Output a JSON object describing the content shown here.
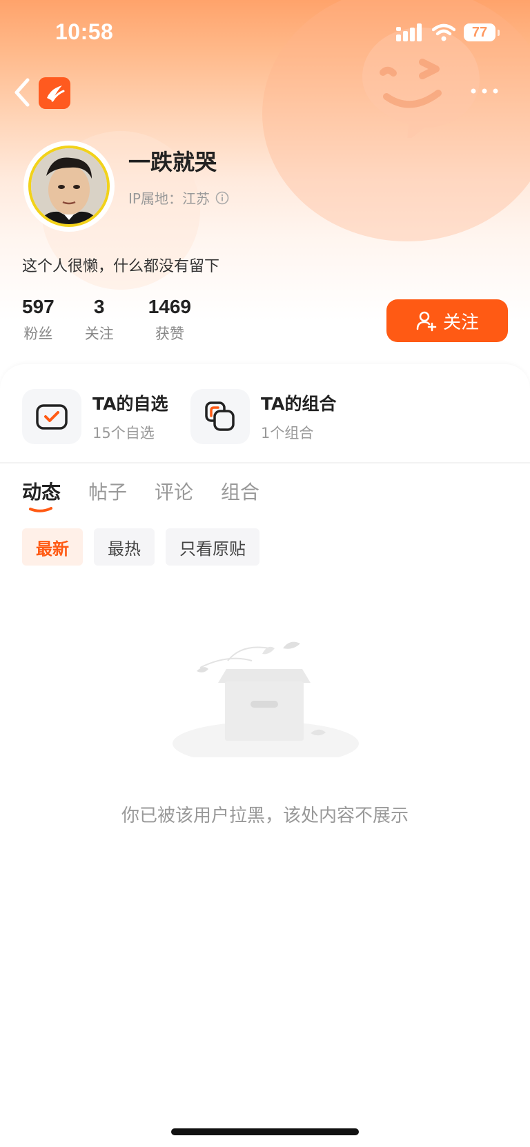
{
  "status_bar": {
    "time": "10:58",
    "battery": "77"
  },
  "nav": {
    "back_icon": "chevron-left-icon",
    "logo_icon": "app-logo-icon",
    "more_icon": "more-icon"
  },
  "profile": {
    "username": "一跌就哭",
    "ip_location": "IP属地：江苏",
    "bio": "这个人很懒，什么都没有留下",
    "stats": [
      {
        "value": "597",
        "label": "粉丝"
      },
      {
        "value": "3",
        "label": "关注"
      },
      {
        "value": "1469",
        "label": "获赞"
      }
    ],
    "follow_button": "关注"
  },
  "quick_links": [
    {
      "title": "TA的自选",
      "subtitle": "15个自选"
    },
    {
      "title": "TA的组合",
      "subtitle": "1个组合"
    }
  ],
  "tabs": [
    {
      "label": "动态",
      "active": true
    },
    {
      "label": "帖子",
      "active": false
    },
    {
      "label": "评论",
      "active": false
    },
    {
      "label": "组合",
      "active": false
    }
  ],
  "filters": [
    {
      "label": "最新",
      "active": true
    },
    {
      "label": "最热",
      "active": false
    },
    {
      "label": "只看原贴",
      "active": false
    }
  ],
  "empty_state": {
    "message": "你已被该用户拉黑，该处内容不展示"
  },
  "colors": {
    "accent": "#ff5a14",
    "header_gradient_top": "#ffa36b"
  }
}
